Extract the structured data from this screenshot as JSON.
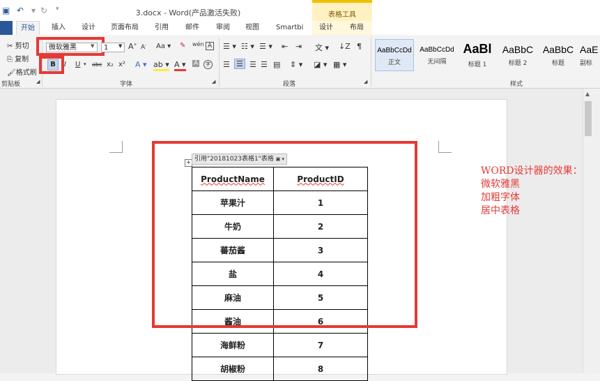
{
  "titlebar": {
    "doc_title": "3.docx - Word(产品激活失败)",
    "contextual_title": "表格工具"
  },
  "tabs": [
    "开始",
    "插入",
    "设计",
    "页面布局",
    "引用",
    "邮件",
    "审阅",
    "视图",
    "Smartbi",
    "设计",
    "布局"
  ],
  "ribbon": {
    "clipboard": {
      "cut": "剪切",
      "copy": "复制",
      "format_painter": "格式刷",
      "group_label": "剪贴板"
    },
    "font": {
      "font_name": "微软雅黑",
      "font_size": "1",
      "bold": "B",
      "italic": "I",
      "underline": "U",
      "strike": "abc",
      "subscript": "x₂",
      "superscript": "x²",
      "case": "Aa",
      "phonetic": "wén",
      "group_label": "字体"
    },
    "paragraph": {
      "group_label": "段落"
    },
    "styles": {
      "group_label": "样式",
      "items": [
        {
          "sample": "AaBbCcDd",
          "name": "正文"
        },
        {
          "sample": "AaBbCcDd",
          "name": "无间隔"
        },
        {
          "sample": "AaBl",
          "name": "标题 1"
        },
        {
          "sample": "AaBbC",
          "name": "标题 2"
        },
        {
          "sample": "AaBbC",
          "name": "标题"
        },
        {
          "sample": "AaE",
          "name": "副标"
        }
      ]
    }
  },
  "document": {
    "binding_label": "引用\"20181023表格1\"表格",
    "table": {
      "headers": [
        "ProductName",
        "ProductID"
      ],
      "rows": [
        [
          "苹果汁",
          "1"
        ],
        [
          "牛奶",
          "2"
        ],
        [
          "蕃茄酱",
          "3"
        ],
        [
          "盐",
          "4"
        ],
        [
          "麻油",
          "5"
        ],
        [
          "酱油",
          "6"
        ],
        [
          "海鲜粉",
          "7"
        ],
        [
          "胡椒粉",
          "8"
        ]
      ]
    },
    "annotation": [
      "WORD设计器的效果：",
      "微软雅黑",
      "加粗字体",
      "居中表格"
    ]
  },
  "colors": {
    "accent": "#2b579a",
    "highlight_box": "#e53935",
    "contextual_tab": "#f0c000"
  }
}
